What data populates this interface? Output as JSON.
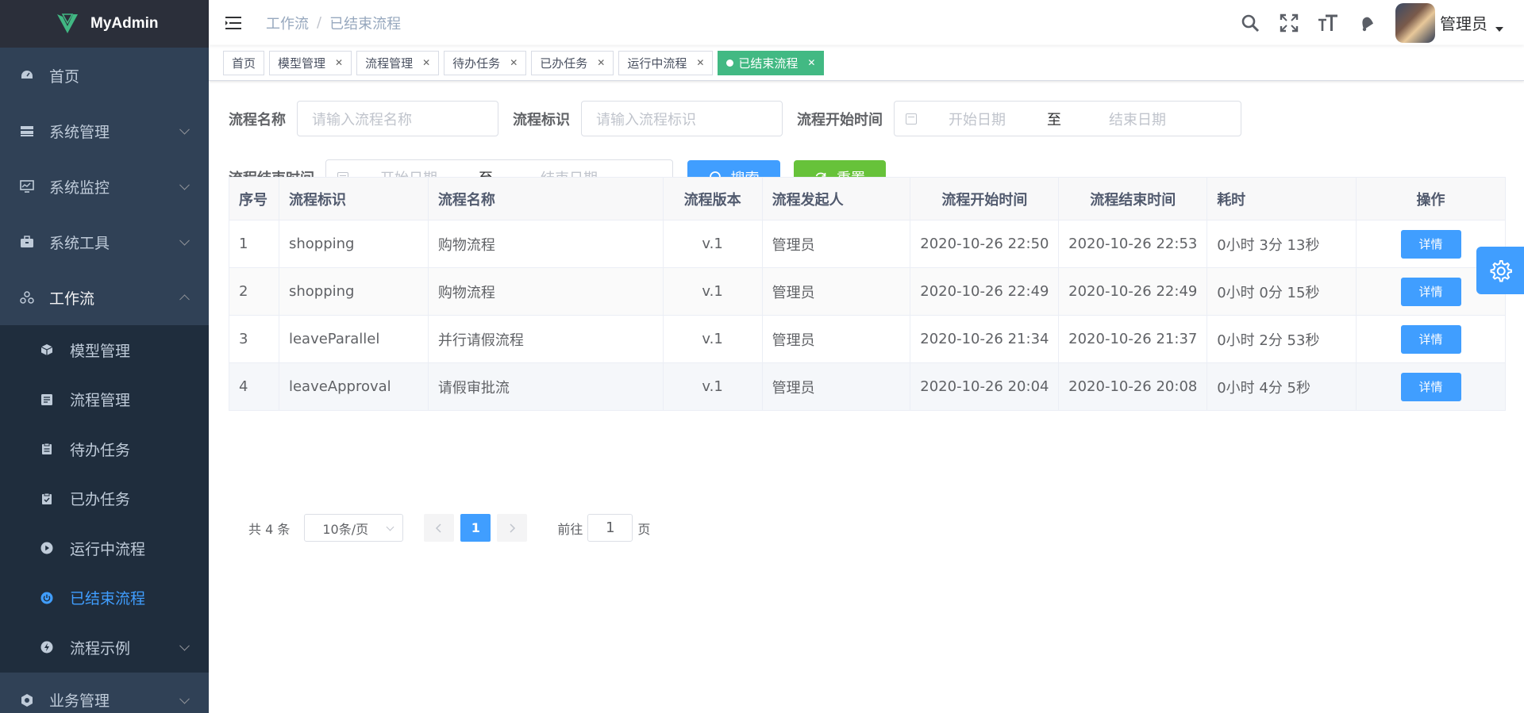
{
  "app": {
    "name": "MyAdmin"
  },
  "sidebar": {
    "items": [
      {
        "label": "首页",
        "icon": "dashboard-icon"
      },
      {
        "label": "系统管理",
        "icon": "system-icon"
      },
      {
        "label": "系统监控",
        "icon": "monitor-icon"
      },
      {
        "label": "系统工具",
        "icon": "tool-icon"
      },
      {
        "label": "工作流",
        "icon": "workflow-icon"
      }
    ],
    "sub_items": [
      {
        "label": "模型管理",
        "icon": "cube-icon"
      },
      {
        "label": "流程管理",
        "icon": "list-icon"
      },
      {
        "label": "待办任务",
        "icon": "clipboard-icon"
      },
      {
        "label": "已办任务",
        "icon": "clipboard-check-icon"
      },
      {
        "label": "运行中流程",
        "icon": "play-icon"
      },
      {
        "label": "已结束流程",
        "icon": "power-icon"
      },
      {
        "label": "流程示例",
        "icon": "bolt-icon"
      }
    ],
    "after_item": {
      "label": "业务管理",
      "icon": "business-icon"
    }
  },
  "header": {
    "breadcrumb": [
      "工作流",
      "已结束流程"
    ],
    "username": "管理员"
  },
  "tags": [
    {
      "label": "首页",
      "closable": false
    },
    {
      "label": "模型管理",
      "closable": true
    },
    {
      "label": "流程管理",
      "closable": true
    },
    {
      "label": "待办任务",
      "closable": true
    },
    {
      "label": "已办任务",
      "closable": true
    },
    {
      "label": "运行中流程",
      "closable": true
    },
    {
      "label": "已结束流程",
      "closable": true,
      "active": true
    }
  ],
  "search": {
    "name_label": "流程名称",
    "name_placeholder": "请输入流程名称",
    "key_label": "流程标识",
    "key_placeholder": "请输入流程标识",
    "start_label": "流程开始时间",
    "end_label": "流程结束时间",
    "start_date_placeholder": "开始日期",
    "to": "至",
    "end_date_placeholder": "结束日期",
    "search_button": "搜索",
    "reset_button": "重置"
  },
  "table": {
    "headers": [
      "序号",
      "流程标识",
      "流程名称",
      "流程版本",
      "流程发起人",
      "流程开始时间",
      "流程结束时间",
      "耗时",
      "操作"
    ],
    "rows": [
      [
        "1",
        "shopping",
        "购物流程",
        "v.1",
        "管理员",
        "2020-10-26 22:50",
        "2020-10-26 22:53",
        "0小时 3分 13秒"
      ],
      [
        "2",
        "shopping",
        "购物流程",
        "v.1",
        "管理员",
        "2020-10-26 22:49",
        "2020-10-26 22:49",
        "0小时 0分 15秒"
      ],
      [
        "3",
        "leaveParallel",
        "并行请假流程",
        "v.1",
        "管理员",
        "2020-10-26 21:34",
        "2020-10-26 21:37",
        "0小时 2分 53秒"
      ],
      [
        "4",
        "leaveApproval",
        "请假审批流",
        "v.1",
        "管理员",
        "2020-10-26 20:04",
        "2020-10-26 20:08",
        "0小时 4分 5秒"
      ]
    ],
    "action_label": "详情"
  },
  "pagination": {
    "total": "共 4 条",
    "page_size": "10条/页",
    "current": "1",
    "goto_prefix": "前往",
    "goto_value": "1",
    "goto_suffix": "页"
  },
  "colors": {
    "primary": "#409eff",
    "success": "#67c23a",
    "tag_active": "#42b983",
    "sidebar": "#304156"
  }
}
